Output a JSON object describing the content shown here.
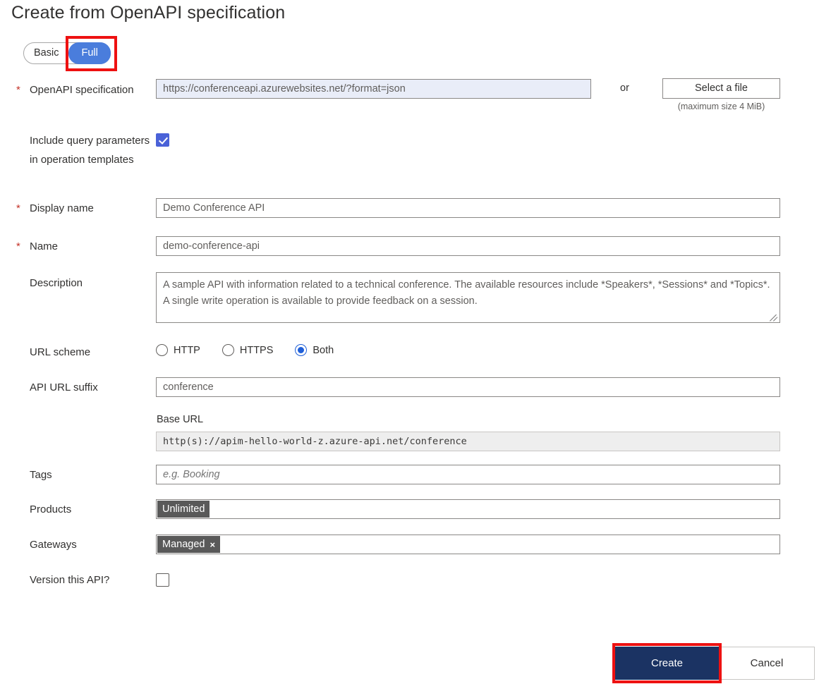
{
  "page_title": "Create from OpenAPI specification",
  "toggle": {
    "options": [
      {
        "label": "Basic",
        "selected": false
      },
      {
        "label": "Full",
        "selected": true
      }
    ]
  },
  "fields": {
    "openapi_spec": {
      "label": "OpenAPI specification",
      "required": true,
      "value": "https://conferenceapi.azurewebsites.net/?format=json",
      "or_text": "or",
      "file_button": "Select a file",
      "file_hint": "(maximum size 4 MiB)"
    },
    "include_query_params": {
      "label": "Include query parameters in operation templates",
      "checked": true
    },
    "display_name": {
      "label": "Display name",
      "required": true,
      "value": "Demo Conference API"
    },
    "name": {
      "label": "Name",
      "required": true,
      "value": "demo-conference-api"
    },
    "description": {
      "label": "Description",
      "value": "A sample API with information related to a technical conference.  The available resources  include *Speakers*, *Sessions* and *Topics*.  A single write operation is available to provide  feedback on a session."
    },
    "url_scheme": {
      "label": "URL scheme",
      "options": [
        {
          "label": "HTTP",
          "selected": false
        },
        {
          "label": "HTTPS",
          "selected": false
        },
        {
          "label": "Both",
          "selected": true
        }
      ]
    },
    "api_url_suffix": {
      "label": "API URL suffix",
      "value": "conference"
    },
    "base_url": {
      "label": "Base URL",
      "value": "http(s)://apim-hello-world-z.azure-api.net/conference"
    },
    "tags": {
      "label": "Tags",
      "placeholder": "e.g. Booking",
      "value": ""
    },
    "products": {
      "label": "Products",
      "chips": [
        {
          "label": "Unlimited",
          "removable": false
        }
      ]
    },
    "gateways": {
      "label": "Gateways",
      "chips": [
        {
          "label": "Managed",
          "removable": true,
          "remove_icon": "×"
        }
      ]
    },
    "version_this_api": {
      "label": "Version this API?",
      "checked": false
    }
  },
  "footer": {
    "create_label": "Create",
    "cancel_label": "Cancel"
  },
  "colors": {
    "accent_blue": "#4a7ddc",
    "checkbox_blue": "#4a62d8",
    "radio_blue": "#1f5fd8",
    "primary_button": "#1b3363",
    "annotation_red": "#ee1111",
    "chip_gray": "#595959",
    "required_star": "#c4342a",
    "focused_field_bg": "#e9edf8"
  }
}
